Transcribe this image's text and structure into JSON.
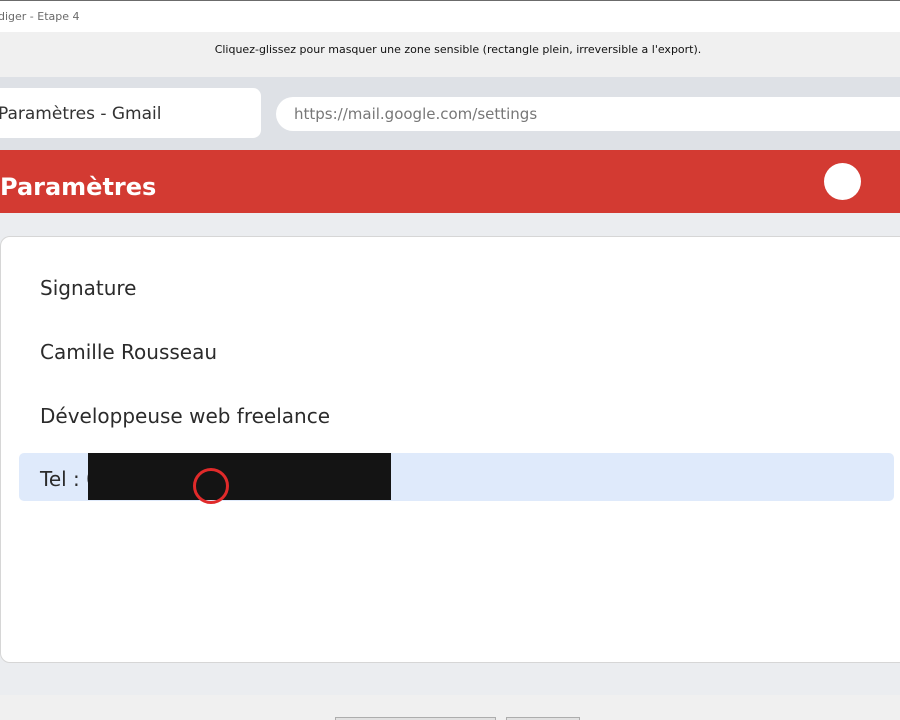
{
  "window": {
    "title": "diger - Etape 4"
  },
  "instruction": {
    "text": "Cliquez-glissez pour masquer une zone sensible (rectangle plein, irreversible a l'export)."
  },
  "browser": {
    "tab_title": "Paramètres - Gmail",
    "address": "https://mail.google.com/settings"
  },
  "gmail": {
    "header_title": "Paramètres",
    "accent_color": "#d33a32",
    "avatar_icon": "user-avatar-circle"
  },
  "signature": {
    "lines": [
      "Signature",
      "Camille Rousseau",
      "Développeuse web freelance",
      "Tel : 0"
    ],
    "highlight_color": "#dfeafb"
  },
  "redaction": {
    "color": "#141414",
    "cursor_color": "#e02a2a"
  }
}
